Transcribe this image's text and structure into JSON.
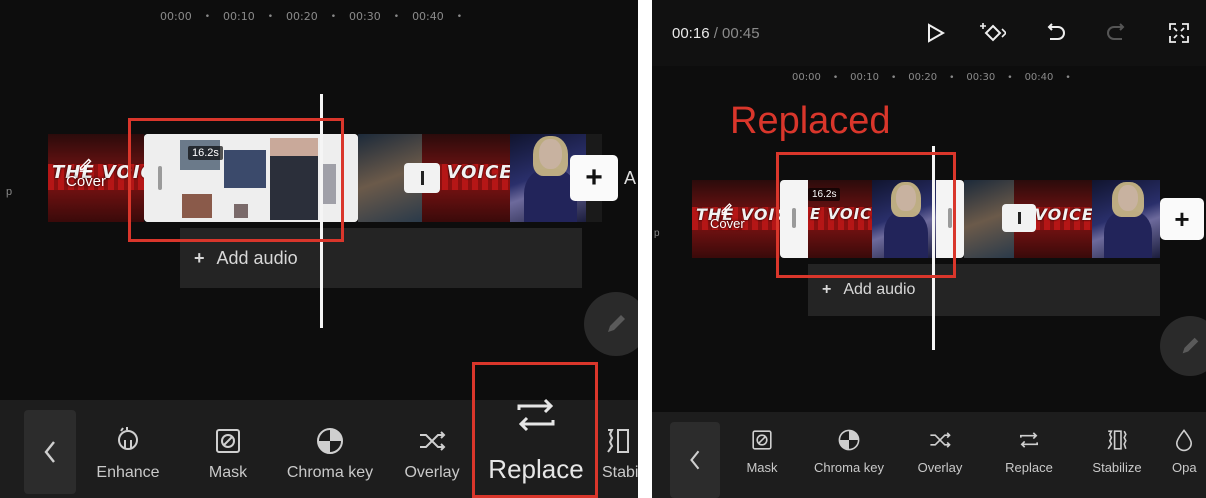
{
  "left": {
    "ruler": [
      "00:00",
      "00:10",
      "00:20",
      "00:30",
      "00:40"
    ],
    "ruler_dot": "•",
    "edge_letter": "p",
    "cover_label": "Cover",
    "clip_duration": "16.2s",
    "voice_text": "THE VOICE",
    "voice_text_2": "E VOICE",
    "add_label_partial": "A",
    "add_audio_label": "Add audio",
    "plus_glyph": "+",
    "tools": [
      {
        "label": "Enhance",
        "icon": "enhance-icon"
      },
      {
        "label": "Mask",
        "icon": "mask-icon"
      },
      {
        "label": "Chroma key",
        "icon": "chroma-key-icon"
      },
      {
        "label": "Overlay",
        "icon": "overlay-icon"
      },
      {
        "label": "Replace",
        "icon": "replace-icon"
      },
      {
        "label": "Stabi",
        "icon": "stabilize-icon"
      }
    ]
  },
  "right": {
    "current_time": "00:16",
    "total_time": " / 00:45",
    "ruler": [
      "00:00",
      "00:10",
      "00:20",
      "00:30",
      "00:40"
    ],
    "ruler_dot": "•",
    "edge_letter": "p",
    "annotation": "Replaced",
    "cover_label": "Cover",
    "clip_duration": "16.2s",
    "voice_text": "THE VOICE",
    "voice_text_2": "E VOICE",
    "add_audio_label": "Add audio",
    "plus_glyph": "+",
    "tools": [
      {
        "label": "Mask",
        "icon": "mask-icon"
      },
      {
        "label": "Chroma key",
        "icon": "chroma-key-icon"
      },
      {
        "label": "Overlay",
        "icon": "overlay-icon"
      },
      {
        "label": "Replace",
        "icon": "replace-icon"
      },
      {
        "label": "Stabilize",
        "icon": "stabilize-icon"
      },
      {
        "label": "Opa",
        "icon": "opacity-icon"
      }
    ]
  },
  "colors": {
    "highlight": "#d9362b",
    "panel_bg": "#0d0d0d",
    "toolbar_bg": "#1d1d1d",
    "text": "#c9c9c9"
  }
}
